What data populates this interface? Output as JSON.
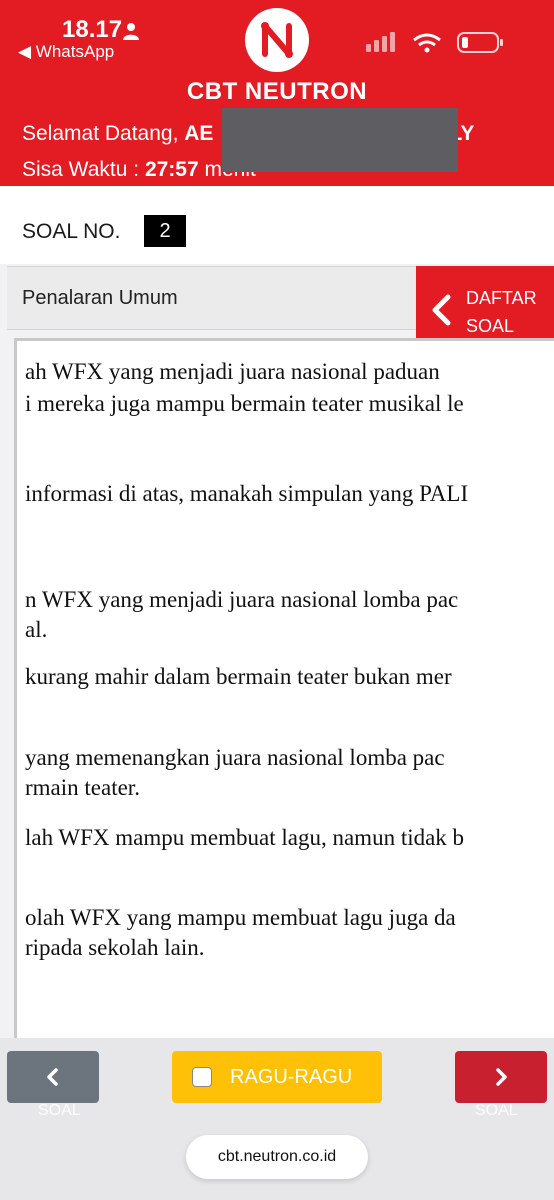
{
  "status_bar": {
    "time": "18.17",
    "back_label": "◀ WhatsApp"
  },
  "header": {
    "title": "CBT NEUTRON",
    "welcome_prefix": "Selamat Datang, ",
    "welcome_name_start": "AE",
    "welcome_name_end": "LY",
    "timer_prefix": "Sisa Waktu : ",
    "timer_value": "27:57",
    "timer_unit": " menit"
  },
  "question": {
    "number_label": "SOAL NO.",
    "number": "2",
    "category": "Penalaran Umum",
    "list_button": [
      "DAFTAR",
      "SOAL"
    ],
    "lines": [
      "ah WFX yang menjadi juara nasional paduan",
      "i mereka juga mampu bermain teater musikal le",
      "informasi di atas, manakah simpulan yang PALI",
      "n WFX yang menjadi juara nasional lomba pac",
      "al.",
      "kurang mahir dalam bermain teater bukan mer",
      "yang memenangkan juara nasional lomba pac",
      "rmain teater.",
      "lah WFX mampu membuat lagu, namun tidak b",
      "olah WFX yang mampu membuat lagu juga da",
      "ripada sekolah lain."
    ]
  },
  "footer": {
    "prev_sub": "SOAL",
    "ragu_label": "RAGU-RAGU",
    "next_sub": "SOAL",
    "url": "cbt.neutron.co.id"
  },
  "colors": {
    "brand_red": "#e31b22",
    "ragu_yellow": "#ffc107",
    "prev_gray": "#6c757d",
    "next_red": "#c8202e"
  }
}
